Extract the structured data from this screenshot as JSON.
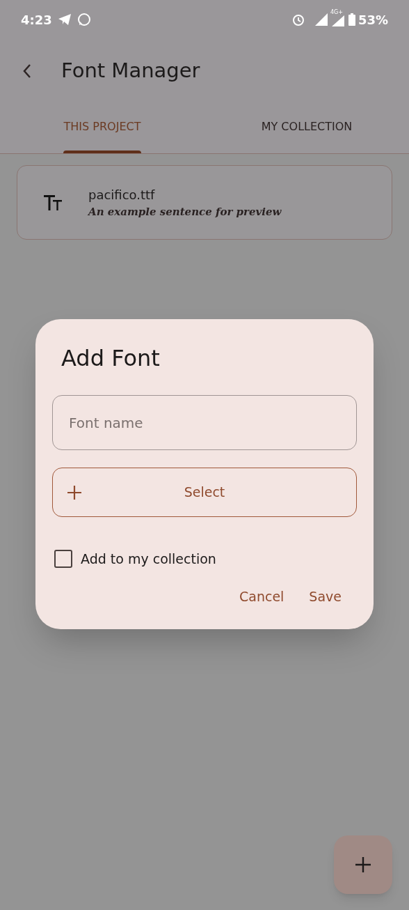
{
  "status_bar": {
    "time": "4:23",
    "network": "4G+",
    "battery": "53%"
  },
  "app_bar": {
    "title": "Font Manager"
  },
  "tabs": [
    {
      "label": "THIS PROJECT",
      "selected": true
    },
    {
      "label": "MY COLLECTION",
      "selected": false
    }
  ],
  "fonts": [
    {
      "name": "pacifico.ttf",
      "preview": "An example sentence for preview"
    }
  ],
  "dialog": {
    "title": "Add Font",
    "name_field": {
      "placeholder": "Font name"
    },
    "select_button": "Select",
    "add_to_collection": {
      "label": "Add to my collection",
      "checked": false
    },
    "buttons": [
      "Cancel",
      "Save"
    ]
  }
}
